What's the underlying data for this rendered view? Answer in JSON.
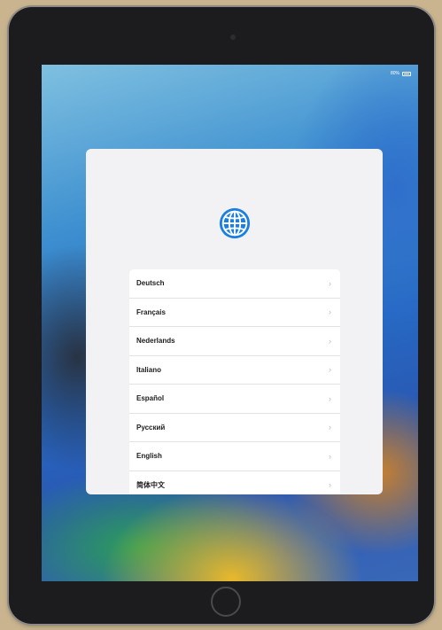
{
  "status_bar": {
    "battery_text": "80%"
  },
  "setup": {
    "icon": "globe-icon",
    "accent_color": "#1a7fe0",
    "languages": [
      {
        "label": "Deutsch"
      },
      {
        "label": "Français"
      },
      {
        "label": "Nederlands"
      },
      {
        "label": "Italiano"
      },
      {
        "label": "Español"
      },
      {
        "label": "Русский"
      },
      {
        "label": "English"
      },
      {
        "label": "简体中文"
      }
    ],
    "chevron": "›"
  }
}
